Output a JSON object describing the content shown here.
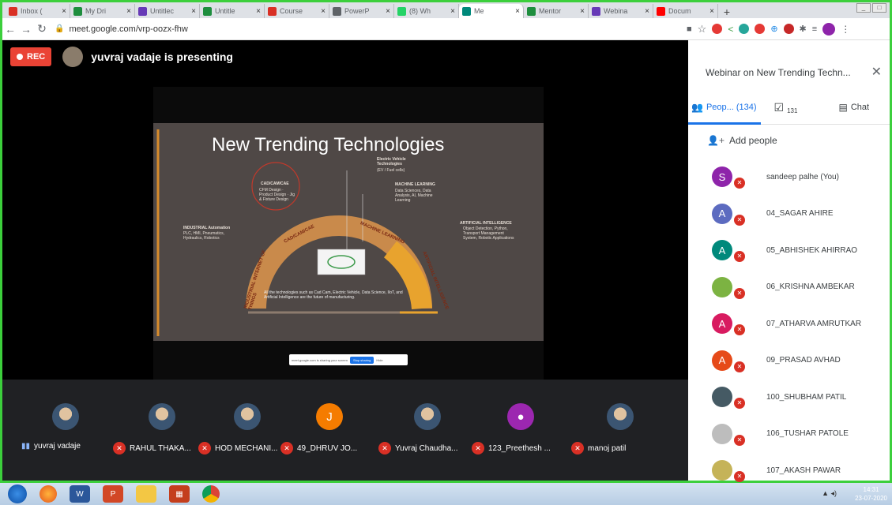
{
  "browser": {
    "tabs": [
      {
        "label": "Inbox (",
        "icon": "gmail-icon",
        "color": "#d93025"
      },
      {
        "label": "My Dri",
        "icon": "drive-icon",
        "color": "#1e8e3e"
      },
      {
        "label": "Untitlec",
        "icon": "forms-icon",
        "color": "#673ab7"
      },
      {
        "label": "Untitle",
        "icon": "sheets-icon",
        "color": "#1e8e3e"
      },
      {
        "label": "Course",
        "icon": "gmail-icon",
        "color": "#d93025"
      },
      {
        "label": "PowerP",
        "icon": "globe-icon",
        "color": "#5f6368"
      },
      {
        "label": "(8) Wh",
        "icon": "whatsapp-icon",
        "color": "#25d366"
      },
      {
        "label": "Me",
        "icon": "meet-icon",
        "color": "#00897b"
      },
      {
        "label": "Mentor",
        "icon": "sheets-icon",
        "color": "#1e8e3e"
      },
      {
        "label": "Webina",
        "icon": "forms-icon",
        "color": "#673ab7"
      },
      {
        "label": "Docum",
        "icon": "youtube-icon",
        "color": "#ff0000"
      }
    ],
    "new_tab": "+",
    "url": "meet.google.com/vrp-oozx-fhw"
  },
  "meeting": {
    "rec_label": "REC",
    "presenting_text": "yuvraj vadaje is presenting",
    "slide": {
      "title": "New Trending Technologies",
      "blocks": [
        {
          "heading": "Electric Vehicle Technologies",
          "body": "(EV / Fuel cells)"
        },
        {
          "heading": "CAD/CAM/CAE",
          "body": "CFM Design · Product Design · Jig & Fixture Design"
        },
        {
          "heading": "MACHINE LEARNING",
          "body": "Data Sciences, Data Analysis, AI, Machine Learning"
        },
        {
          "heading": "INDUSTRIAL Automation",
          "body": "PLC, HMI, Pneumatics, Hydraulics, Robotics"
        },
        {
          "heading": "ARTIFICIAL INTELLIGENCE",
          "body": "Object Detection, Python, Transport Management System, Robotic Applications"
        }
      ],
      "arc_labels": [
        "INDUSTRIAL INTERNET OF THINGS",
        "CAD/CAM/CAE",
        "MACHINE LEARNING",
        "ARTIFICIAL INTELLIGENCE"
      ],
      "caption": "All the technologies such as Cad Cam, Electric Vehicle, Data Science, IIoT, and Artificial Intelligence are the future of manufacturing."
    },
    "share_banner": {
      "text": "meet.google.com is sharing your screen",
      "button": "Stop sharing",
      "hide": "Hide"
    }
  },
  "strip": [
    {
      "name": "yuvraj vadaje",
      "avatar": "photo",
      "speaking": true
    },
    {
      "name": "RAHUL THAKA...",
      "avatar": "photo"
    },
    {
      "name": "HOD MECHANI...",
      "avatar": "photo"
    },
    {
      "name": "49_DHRUV JO...",
      "avatar": "J",
      "color": "#f57c00"
    },
    {
      "name": "Yuvraj Chaudha...",
      "avatar": "photo"
    },
    {
      "name": "123_Preethesh ...",
      "avatar": "person",
      "color": "#9c27b0"
    },
    {
      "name": "manoj patil",
      "avatar": "photo"
    }
  ],
  "panel": {
    "title": "Webinar on New Trending Techn...",
    "people_tab": "Peop... (134)",
    "tasks_count": "131",
    "chat_tab": "Chat",
    "add_people": "Add people",
    "participants": [
      {
        "initial": "S",
        "color": "#8e24aa",
        "name": "sandeep palhe (You)"
      },
      {
        "initial": "A",
        "color": "#5c6bc0",
        "name": "04_SAGAR AHIRE"
      },
      {
        "initial": "A",
        "color": "#00897b",
        "name": "05_ABHISHEK AHIRRAO"
      },
      {
        "initial": "",
        "color": "#7cb342",
        "name": "06_KRISHNA AMBEKAR"
      },
      {
        "initial": "A",
        "color": "#d81b60",
        "name": "07_ATHARVA AMRUTKAR"
      },
      {
        "initial": "A",
        "color": "#e64a19",
        "name": "09_PRASAD AVHAD"
      },
      {
        "initial": "",
        "color": "#455a64",
        "name": "100_SHUBHAM PATIL"
      },
      {
        "initial": "",
        "color": "#bdbdbd",
        "name": "106_TUSHAR PATOLE"
      },
      {
        "initial": "",
        "color": "#c5b358",
        "name": "107_AKASH PAWAR"
      }
    ]
  },
  "taskbar": {
    "time": "14:31",
    "date": "23-07-2020"
  }
}
